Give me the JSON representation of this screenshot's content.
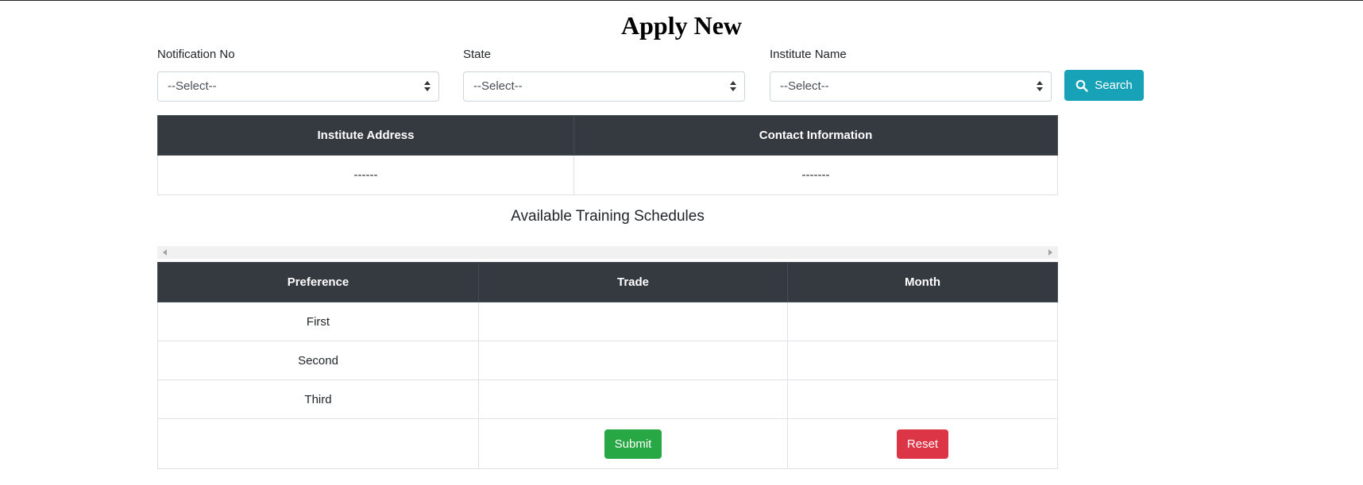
{
  "page": {
    "title": "Apply New"
  },
  "filters": {
    "notification": {
      "label": "Notification No",
      "value": "--Select--"
    },
    "state": {
      "label": "State",
      "value": "--Select--"
    },
    "institute": {
      "label": "Institute Name",
      "value": "--Select--"
    },
    "search_button": {
      "label": "Search",
      "icon": "search-icon"
    }
  },
  "institute_info": {
    "headers": [
      "Institute Address",
      "Contact Information"
    ],
    "row": [
      "------",
      "-------"
    ]
  },
  "schedules": {
    "heading": "Available Training Schedules",
    "headers": [
      "Preference",
      "Trade",
      "Month"
    ],
    "rows": [
      {
        "preference": "First",
        "trade": "",
        "month": ""
      },
      {
        "preference": "Second",
        "trade": "",
        "month": ""
      },
      {
        "preference": "Third",
        "trade": "",
        "month": ""
      }
    ],
    "submit_label": "Submit",
    "reset_label": "Reset"
  },
  "colors": {
    "header_bg": "#343a40",
    "search": "#17a2b8",
    "submit": "#28a745",
    "reset": "#dc3545"
  }
}
